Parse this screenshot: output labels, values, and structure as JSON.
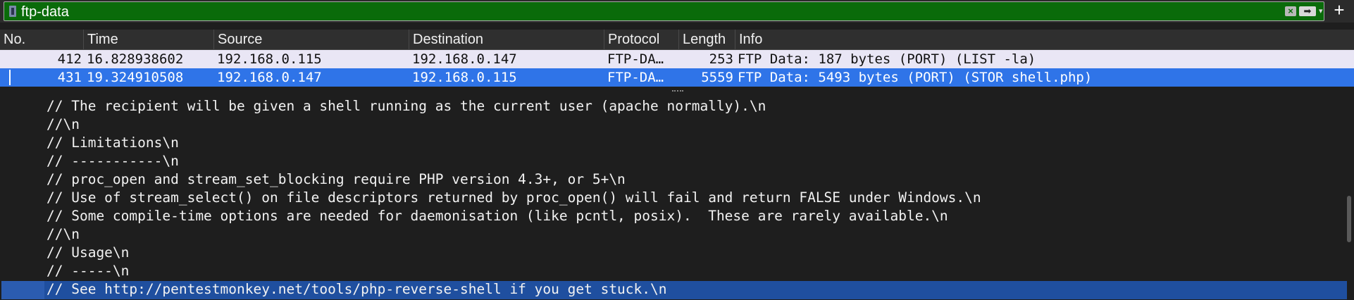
{
  "filter": {
    "value": "ftp-data",
    "add_label": "+",
    "clear_glyph": "×",
    "apply_glyph": "➡",
    "recent_glyph": "▾",
    "bar_color": "#0a6b0a"
  },
  "packet_list": {
    "columns": [
      "No.",
      "Time",
      "Source",
      "Destination",
      "Protocol",
      "Length",
      "Info"
    ],
    "rows": [
      {
        "no": "412",
        "time": "16.828938602",
        "source": "192.168.0.115",
        "destination": "192.168.0.147",
        "protocol": "FTP-DA…",
        "length": "253",
        "info": "FTP Data: 187 bytes (PORT) (LIST -la)",
        "selected": false
      },
      {
        "no": "431",
        "time": "19.324910508",
        "source": "192.168.0.147",
        "destination": "192.168.0.115",
        "protocol": "FTP-DA…",
        "length": "5559",
        "info": "FTP Data: 5493 bytes (PORT) (STOR shell.php)",
        "selected": true
      }
    ]
  },
  "text_view": {
    "lines": [
      "// The recipient will be given a shell running as the current user (apache normally).\\n",
      "//\\n",
      "// Limitations\\n",
      "// -----------\\n",
      "// proc_open and stream_set_blocking require PHP version 4.3+, or 5+\\n",
      "// Use of stream_select() on file descriptors returned by proc_open() will fail and return FALSE under Windows.\\n",
      "// Some compile-time options are needed for daemonisation (like pcntl, posix).  These are rarely available.\\n",
      "//\\n",
      "// Usage\\n",
      "// -----\\n",
      "// See http://pentestmonkey.net/tools/php-reverse-shell if you get stuck.\\n"
    ],
    "highlighted_line": 10
  },
  "colors": {
    "selected_row": "#2f74e8",
    "alt_row": "#e9e6f5",
    "highlight_line": "#1f4f9f"
  }
}
